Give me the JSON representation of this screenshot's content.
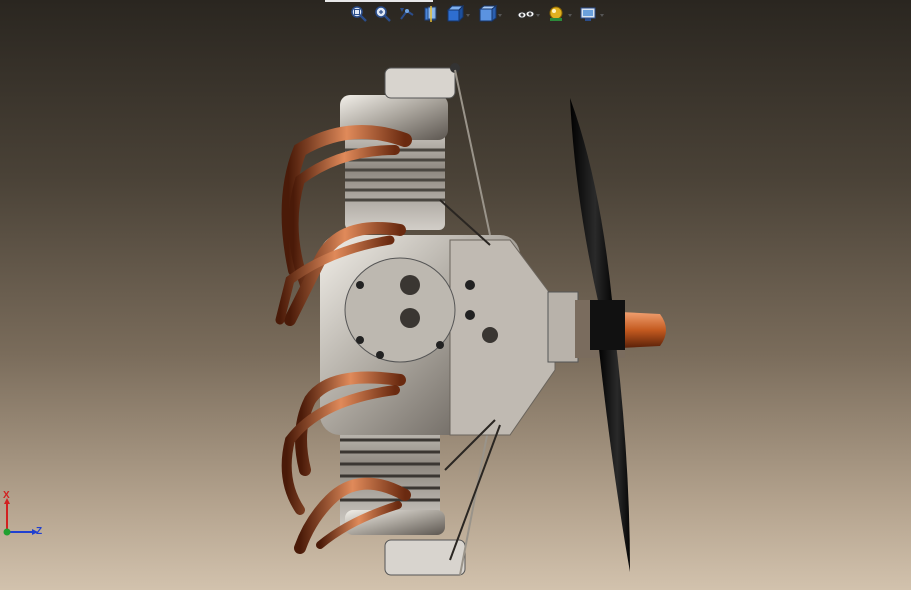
{
  "toolbar": {
    "buttons": [
      {
        "name": "zoom-to-fit",
        "icon": "zoom-to-fit-icon",
        "dropdown": false
      },
      {
        "name": "zoom-to-area",
        "icon": "zoom-to-area-icon",
        "dropdown": false
      },
      {
        "name": "previous-view",
        "icon": "previous-view-icon",
        "dropdown": false
      },
      {
        "name": "section-view",
        "icon": "section-view-icon",
        "dropdown": false
      },
      {
        "name": "view-orientation",
        "icon": "view-orientation-icon",
        "dropdown": true
      },
      {
        "name": "display-style",
        "icon": "display-style-icon",
        "dropdown": true
      },
      {
        "name": "hide-show-items",
        "icon": "hide-show-items-icon",
        "dropdown": true
      },
      {
        "name": "edit-appearance",
        "icon": "edit-appearance-icon",
        "dropdown": true
      },
      {
        "name": "view-settings",
        "icon": "view-settings-icon",
        "dropdown": true
      }
    ]
  },
  "triad": {
    "x_label": "X",
    "z_label": "Z",
    "x_color": "#d22020",
    "z_color": "#2040d0",
    "y_color": "#20a030"
  },
  "colors": {
    "copper": "#b5532a",
    "aluminum": "#c8c4be",
    "dark_metal": "#3a3632",
    "propeller": "#0c0c0c"
  }
}
